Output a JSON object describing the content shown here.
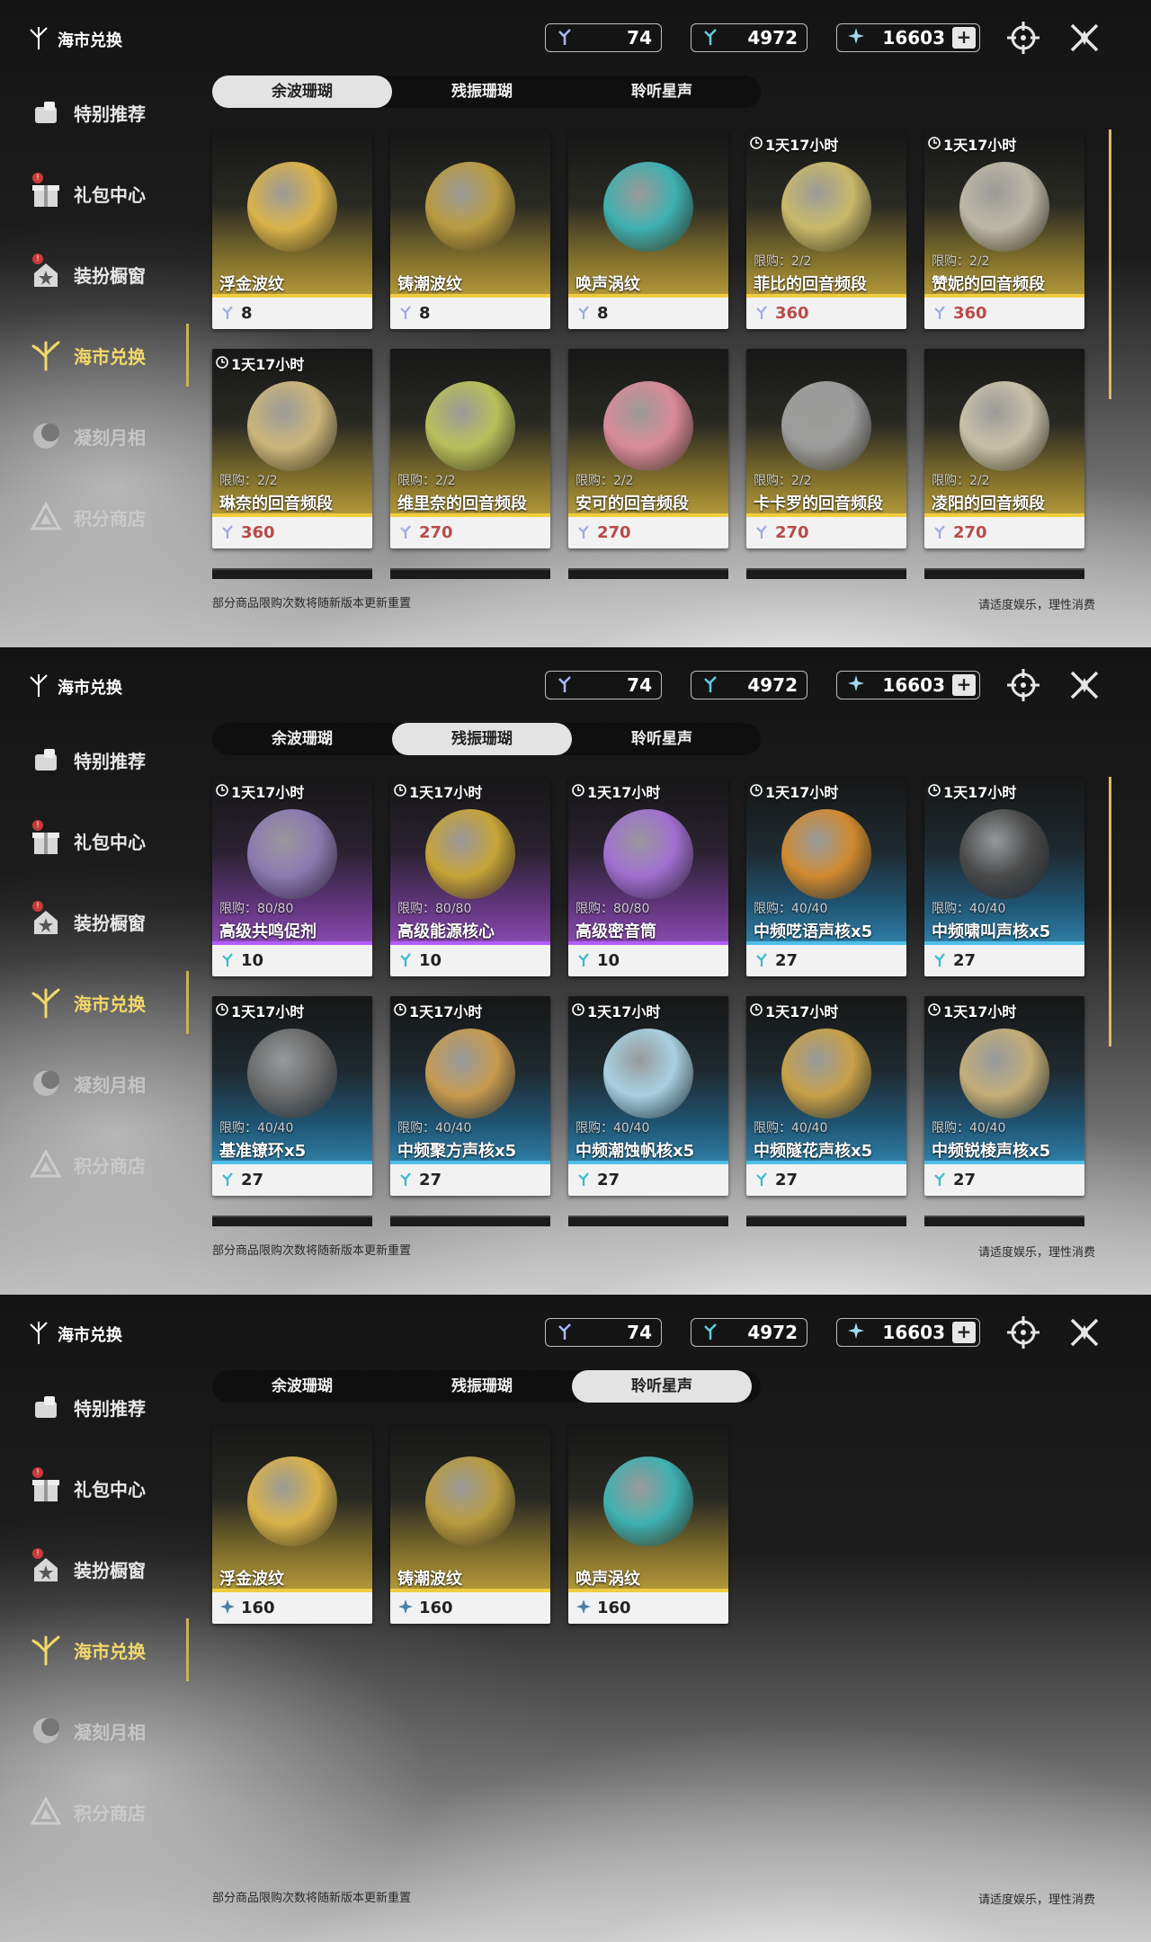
{
  "brand": {
    "label": "海市兑换"
  },
  "currency": {
    "c1": "74",
    "c2": "4972",
    "c3": "16603",
    "plus": "+"
  },
  "sidebar": {
    "items": [
      {
        "label": "特别推荐"
      },
      {
        "label": "礼包中心"
      },
      {
        "label": "装扮橱窗"
      },
      {
        "label": "海市兑换"
      },
      {
        "label": "凝刻月相"
      },
      {
        "label": "积分商店"
      }
    ]
  },
  "tabs": [
    "余波珊瑚",
    "残振珊瑚",
    "聆听星声"
  ],
  "footer": {
    "left": "部分商品限购次数将随新版本更新重置",
    "right": "请适度娱乐，理性消费"
  },
  "panels": [
    {
      "active_tab": 0,
      "cards": [
        {
          "name": "浮金波纹",
          "price": "8",
          "timer": "",
          "limit": "",
          "style": "gold",
          "orb": "#d9b24a",
          "price_icon": "coral-icon"
        },
        {
          "name": "铸潮波纹",
          "price": "8",
          "timer": "",
          "limit": "",
          "style": "gold",
          "orb": "#b89a40",
          "price_icon": "coral-icon"
        },
        {
          "name": "唤声涡纹",
          "price": "8",
          "timer": "",
          "limit": "",
          "style": "gold",
          "orb": "#3fb0b0",
          "price_icon": "coral-icon"
        },
        {
          "name": "菲比的回音频段",
          "price": "360",
          "timer": "1天17小时",
          "limit": "限购：2/2",
          "style": "gold",
          "orb": "#c9b96a",
          "price_icon": "coral-icon",
          "red": true
        },
        {
          "name": "赞妮的回音频段",
          "price": "360",
          "timer": "1天17小时",
          "limit": "限购：2/2",
          "style": "gold",
          "orb": "#bdb7a5",
          "price_icon": "coral-icon",
          "red": true
        },
        {
          "name": "琳奈的回音频段",
          "price": "360",
          "timer": "1天17小时",
          "limit": "限购：2/2",
          "style": "gold",
          "orb": "#cbb57a",
          "price_icon": "coral-icon",
          "red": true
        },
        {
          "name": "维里奈的回音频段",
          "price": "270",
          "timer": "",
          "limit": "限购：2/2",
          "style": "gold",
          "orb": "#b7bf5a",
          "price_icon": "coral-icon",
          "red": true
        },
        {
          "name": "安可的回音频段",
          "price": "270",
          "timer": "",
          "limit": "限购：2/2",
          "style": "gold",
          "orb": "#d98a9a",
          "price_icon": "coral-icon",
          "red": true
        },
        {
          "name": "卡卡罗的回音频段",
          "price": "270",
          "timer": "",
          "limit": "限购：2/2",
          "style": "gold",
          "orb": "#9c9c9c",
          "price_icon": "coral-icon",
          "red": true
        },
        {
          "name": "凌阳的回音频段",
          "price": "270",
          "timer": "",
          "limit": "限购：2/2",
          "style": "gold",
          "orb": "#c7c0a8",
          "price_icon": "coral-icon",
          "red": true
        }
      ]
    },
    {
      "active_tab": 1,
      "cards": [
        {
          "name": "高级共鸣促剂",
          "price": "10",
          "timer": "1天17小时",
          "limit": "限购：80/80",
          "style": "purple",
          "orb": "#8a7ab0",
          "price_icon": "resonance-icon"
        },
        {
          "name": "高级能源核心",
          "price": "10",
          "timer": "1天17小时",
          "limit": "限购：80/80",
          "style": "purple",
          "orb": "#c6a436",
          "price_icon": "resonance-icon"
        },
        {
          "name": "高级密音筒",
          "price": "10",
          "timer": "1天17小时",
          "limit": "限购：80/80",
          "style": "purple",
          "orb": "#a070d0",
          "price_icon": "resonance-icon"
        },
        {
          "name": "中频呓语声核x5",
          "price": "27",
          "timer": "1天17小时",
          "limit": "限购：40/40",
          "style": "blue",
          "orb": "#d08a30",
          "price_icon": "resonance-icon"
        },
        {
          "name": "中频啸叫声核x5",
          "price": "27",
          "timer": "1天17小时",
          "limit": "限购：40/40",
          "style": "blue",
          "orb": "#4a4a4a",
          "price_icon": "resonance-icon"
        },
        {
          "name": "基准镣环x5",
          "price": "27",
          "timer": "1天17小时",
          "limit": "限购：40/40",
          "style": "blue",
          "orb": "#6a6a6a",
          "price_icon": "resonance-icon"
        },
        {
          "name": "中频聚方声核x5",
          "price": "27",
          "timer": "1天17小时",
          "limit": "限购：40/40",
          "style": "blue",
          "orb": "#c79a50",
          "price_icon": "resonance-icon"
        },
        {
          "name": "中频潮蚀帆核x5",
          "price": "27",
          "timer": "1天17小时",
          "limit": "限购：40/40",
          "style": "blue",
          "orb": "#a8d0e0",
          "price_icon": "resonance-icon"
        },
        {
          "name": "中频隧花声核x5",
          "price": "27",
          "timer": "1天17小时",
          "limit": "限购：40/40",
          "style": "blue",
          "orb": "#c8a048",
          "price_icon": "resonance-icon"
        },
        {
          "name": "中频锐棱声核x5",
          "price": "27",
          "timer": "1天17小时",
          "limit": "限购：40/40",
          "style": "blue",
          "orb": "#c4ad78",
          "price_icon": "resonance-icon"
        }
      ]
    },
    {
      "active_tab": 2,
      "cards": [
        {
          "name": "浮金波纹",
          "price": "160",
          "timer": "",
          "limit": "",
          "style": "gold",
          "orb": "#d9b24a",
          "price_icon": "star-sound-icon"
        },
        {
          "name": "铸潮波纹",
          "price": "160",
          "timer": "",
          "limit": "",
          "style": "gold",
          "orb": "#b89a40",
          "price_icon": "star-sound-icon"
        },
        {
          "name": "唤声涡纹",
          "price": "160",
          "timer": "",
          "limit": "",
          "style": "gold",
          "orb": "#3fb0b0",
          "price_icon": "star-sound-icon"
        }
      ]
    }
  ]
}
